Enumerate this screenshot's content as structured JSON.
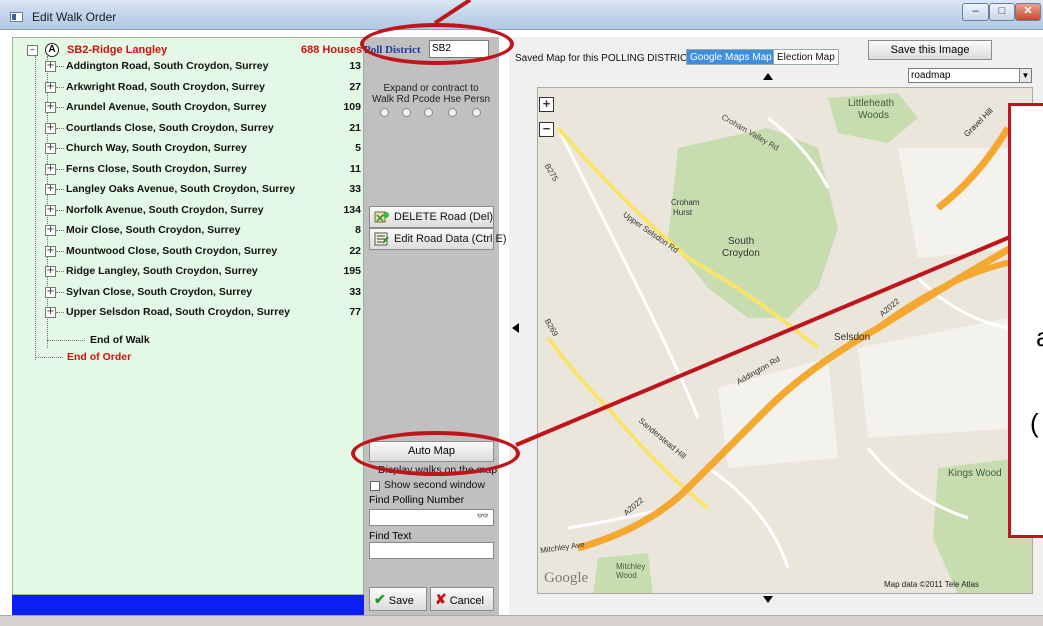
{
  "window": {
    "title": "Edit Walk Order"
  },
  "tree": {
    "root_label": "SB2-Ridge Langley",
    "root_count": "688 Houses",
    "roads": [
      {
        "name": "Addington Road, South Croydon, Surrey",
        "count": "13"
      },
      {
        "name": "Arkwright Road, South Croydon, Surrey",
        "count": "27"
      },
      {
        "name": "Arundel Avenue, South Croydon, Surrey",
        "count": "109"
      },
      {
        "name": "Courtlands Close, South Croydon, Surrey",
        "count": "21"
      },
      {
        "name": "Church Way, South Croydon, Surrey",
        "count": "5"
      },
      {
        "name": "Ferns Close, South Croydon, Surrey",
        "count": "11"
      },
      {
        "name": "Langley Oaks Avenue, South Croydon, Surrey",
        "count": "33"
      },
      {
        "name": "Norfolk Avenue, South Croydon, Surrey",
        "count": "134"
      },
      {
        "name": "Moir Close, South Croydon, Surrey",
        "count": "8"
      },
      {
        "name": "Mountwood Close, South Croydon, Surrey",
        "count": "22"
      },
      {
        "name": "Ridge Langley, South Croydon, Surrey",
        "count": "195"
      },
      {
        "name": "Sylvan Close, South Croydon, Surrey",
        "count": "33"
      },
      {
        "name": "Upper Selsdon Road, South Croydon, Surrey",
        "count": "77"
      }
    ],
    "end_of_walk": "End of Walk",
    "end_of_order": "End of Order"
  },
  "middle": {
    "poll_district_label": "Poll District",
    "poll_district_value": "SB2",
    "expand_text": "Expand or contract to Walk Rd Pcode Hse Persn",
    "delete_road": "DELETE Road (Del)",
    "edit_road": "Edit Road Data (Ctrl E)",
    "auto_map": "Auto Map",
    "display_walks": "Display walks on the map",
    "show_second": "Show second window",
    "find_polling_label": "Find Polling Number",
    "find_text_label": "Find Text",
    "save": "Save",
    "cancel": "Cancel"
  },
  "map": {
    "saved_map_label": "Saved Map for this POLLING DISTRICT",
    "tab_google": "Google Maps Map",
    "tab_election": "Election Map",
    "save_image": "Save this Image",
    "map_type": "roadmap",
    "labels": {
      "littleheath": "Littleheath",
      "woods": "Woods",
      "croham": "Croham",
      "hurst": "Hurst",
      "south": "South",
      "croydon": "Croydon",
      "selsdon": "Selsdon",
      "kings_wood": "Kings Wood",
      "mitchley_wood": "Mitchley Wood",
      "gravel_hill": "Gravel Hill",
      "croham_valley": "Croham Valley Rd",
      "upper_selsdon": "Upper Selsdon Rd",
      "addington_rd": "Addington Rd",
      "sanderstead_hill": "Sanderstead Hill",
      "a2022_a": "A2022",
      "a2022_b": "A2022",
      "b275": "B275",
      "b269": "B269",
      "mitchley_ave": "Mitchley Ave",
      "google": "Google",
      "attribution": "Map data ©2011 Tele Atlas"
    }
  },
  "annotation": {
    "letter_a": "a",
    "paren": "("
  },
  "colors": {
    "tree_bg": "#e3f9e6",
    "root_red": "#d11010",
    "annotation_red": "#c0141c",
    "status_blue": "#0a1ff5",
    "major_road": "#f5a830"
  }
}
